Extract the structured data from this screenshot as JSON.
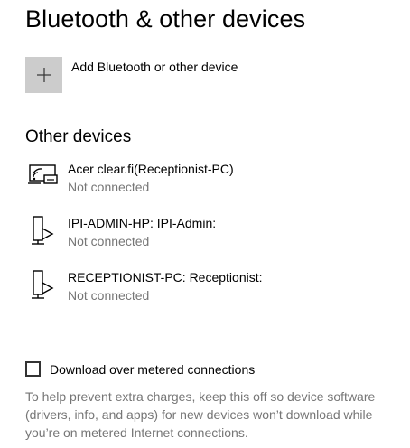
{
  "page": {
    "title": "Bluetooth & other devices"
  },
  "add_device": {
    "label": "Add Bluetooth or other device",
    "icon": "plus-icon"
  },
  "other_devices": {
    "title": "Other devices",
    "items": [
      {
        "name": "Acer clear.fi(Receptionist-PC)",
        "status": "Not connected",
        "icon": "wireless-display-icon"
      },
      {
        "name": "IPI-ADMIN-HP: IPI-Admin:",
        "status": "Not connected",
        "icon": "media-device-icon"
      },
      {
        "name": "RECEPTIONIST-PC: Receptionist:",
        "status": "Not connected",
        "icon": "media-device-icon"
      }
    ]
  },
  "metered": {
    "checkbox_label": "Download over metered connections",
    "checked": false,
    "help_text": "To help prevent extra charges, keep this off so device software (drivers, info, and apps) for new devices won’t download while you’re on metered Internet connections."
  },
  "colors": {
    "tile_bg": "#cccccc",
    "secondary_text": "#767676"
  }
}
